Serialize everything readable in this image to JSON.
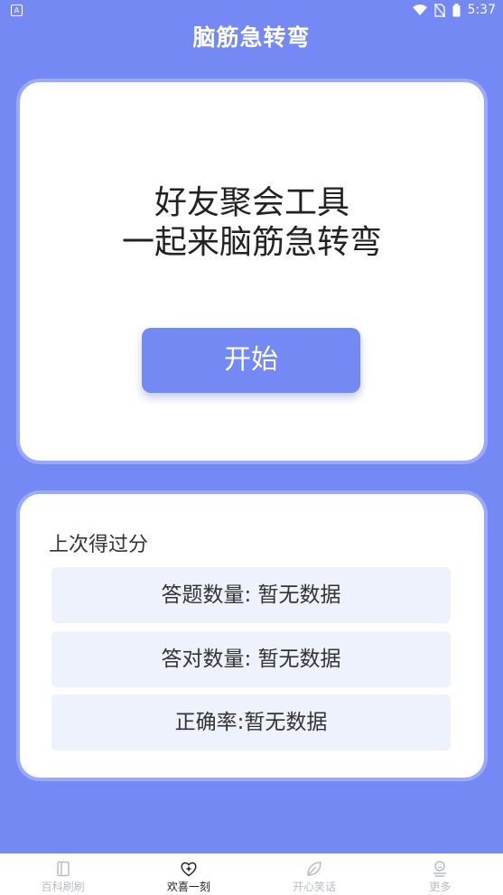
{
  "status_bar": {
    "app_icon_letter": "A",
    "time": "5:37"
  },
  "header": {
    "title": "脑筋急转弯"
  },
  "main_card": {
    "headline_line1": "好友聚会工具",
    "headline_line2": "一起来脑筋急转弯",
    "start_button": "开始"
  },
  "score_card": {
    "title": "上次得过分",
    "rows": [
      "答题数量: 暂无数据",
      "答对数量: 暂无数据",
      "正确率:暂无数据"
    ]
  },
  "tabs": [
    {
      "label": "百科刷刷",
      "icon": "book-icon"
    },
    {
      "label": "欢喜一刻",
      "icon": "heart-plus-icon",
      "active": true
    },
    {
      "label": "开心笑话",
      "icon": "leaf-icon"
    },
    {
      "label": "更多",
      "icon": "person-icon"
    }
  ],
  "colors": {
    "primary": "#7489f4",
    "row_bg": "#eef2fc"
  }
}
